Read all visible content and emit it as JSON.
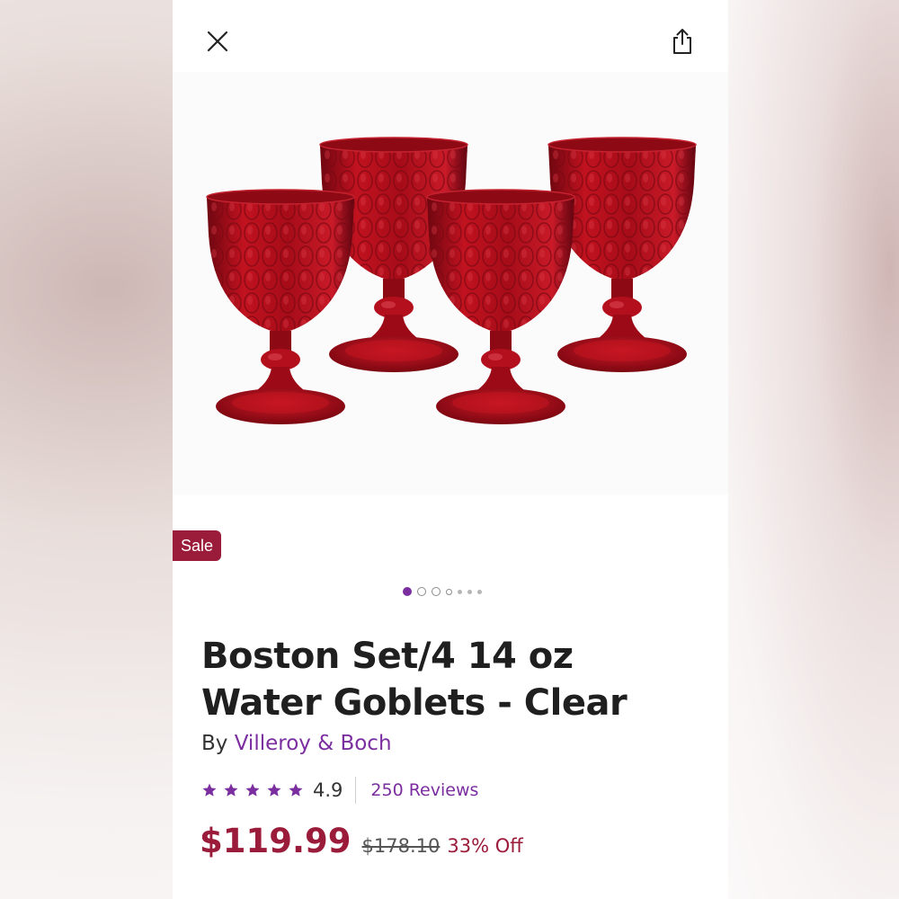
{
  "header": {
    "close_icon": "close-icon",
    "share_icon": "share-icon"
  },
  "product": {
    "badge": "Sale",
    "image_count": 7,
    "active_image_index": 0,
    "title": "Boston Set/4 14 oz Water Goblets - Clear",
    "by_label": "By",
    "brand": "Villeroy & Boch",
    "rating": "4.9",
    "rating_value": 4.9,
    "star_count": 5,
    "reviews_label": "250 Reviews",
    "price": "$119.99",
    "original_price": "$178.10",
    "discount": "33% Off"
  },
  "colors": {
    "accent_purple": "#7b2ea0",
    "sale_red": "#9b1b3a",
    "goblet_red": "#b0101e"
  }
}
